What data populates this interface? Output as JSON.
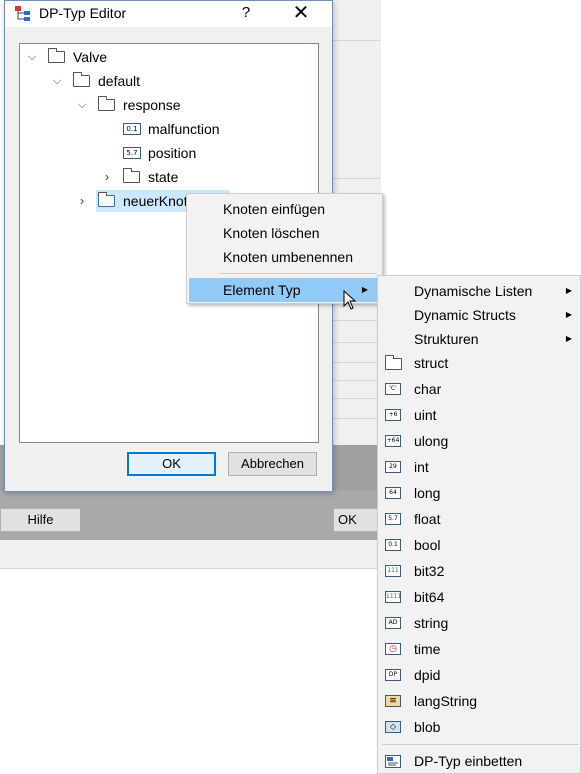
{
  "dialog": {
    "title": "DP-Typ Editor",
    "help_label": "?",
    "close_label": "✕",
    "ok_label": "OK",
    "cancel_label": "Abbrechen"
  },
  "tree": {
    "root": "Valve",
    "default": "default",
    "response": "response",
    "malfunction": "malfunction",
    "malfunction_icon_text": "0.1",
    "position": "position",
    "position_icon_text": "5.7",
    "state": "state",
    "new_node": "neuerKnoten"
  },
  "background": {
    "help_button": "Hilfe",
    "ok_button_partial": "OK"
  },
  "context_menu": {
    "insert": "Knoten einfügen",
    "delete": "Knoten löschen",
    "rename": "Knoten umbenennen",
    "element_type": "Element Typ"
  },
  "submenu": {
    "dynamic_lists": "Dynamische Listen",
    "dynamic_structs": "Dynamic Structs",
    "structures": "Strukturen",
    "types": [
      {
        "label": "struct",
        "icon": "folder-icon",
        "icon_text": ""
      },
      {
        "label": "char",
        "icon": "char-icon",
        "icon_text": "'C'"
      },
      {
        "label": "uint",
        "icon": "uint-icon",
        "icon_text": "+6"
      },
      {
        "label": "ulong",
        "icon": "ulong-icon",
        "icon_text": "+64"
      },
      {
        "label": "int",
        "icon": "int-icon",
        "icon_text": "29"
      },
      {
        "label": "long",
        "icon": "long-icon",
        "icon_text": "64"
      },
      {
        "label": "float",
        "icon": "float-icon",
        "icon_text": "5.7"
      },
      {
        "label": "bool",
        "icon": "bool-icon",
        "icon_text": "0.1"
      },
      {
        "label": "bit32",
        "icon": "bit32-icon",
        "icon_text": "111"
      },
      {
        "label": "bit64",
        "icon": "bit64-icon",
        "icon_text": "1111"
      },
      {
        "label": "string",
        "icon": "string-icon",
        "icon_text": "AD"
      },
      {
        "label": "time",
        "icon": "clock-icon",
        "icon_text": "◷"
      },
      {
        "label": "dpid",
        "icon": "dpid-icon",
        "icon_text": "DP"
      },
      {
        "label": "langString",
        "icon": "flag-icon",
        "icon_text": "≡"
      },
      {
        "label": "blob",
        "icon": "blob-icon",
        "icon_text": "◇"
      }
    ],
    "embed": "DP-Typ einbetten"
  },
  "colors": {
    "selection": "#cce8ff",
    "menu_highlight": "#91c9f7",
    "accent": "#0078d7"
  }
}
